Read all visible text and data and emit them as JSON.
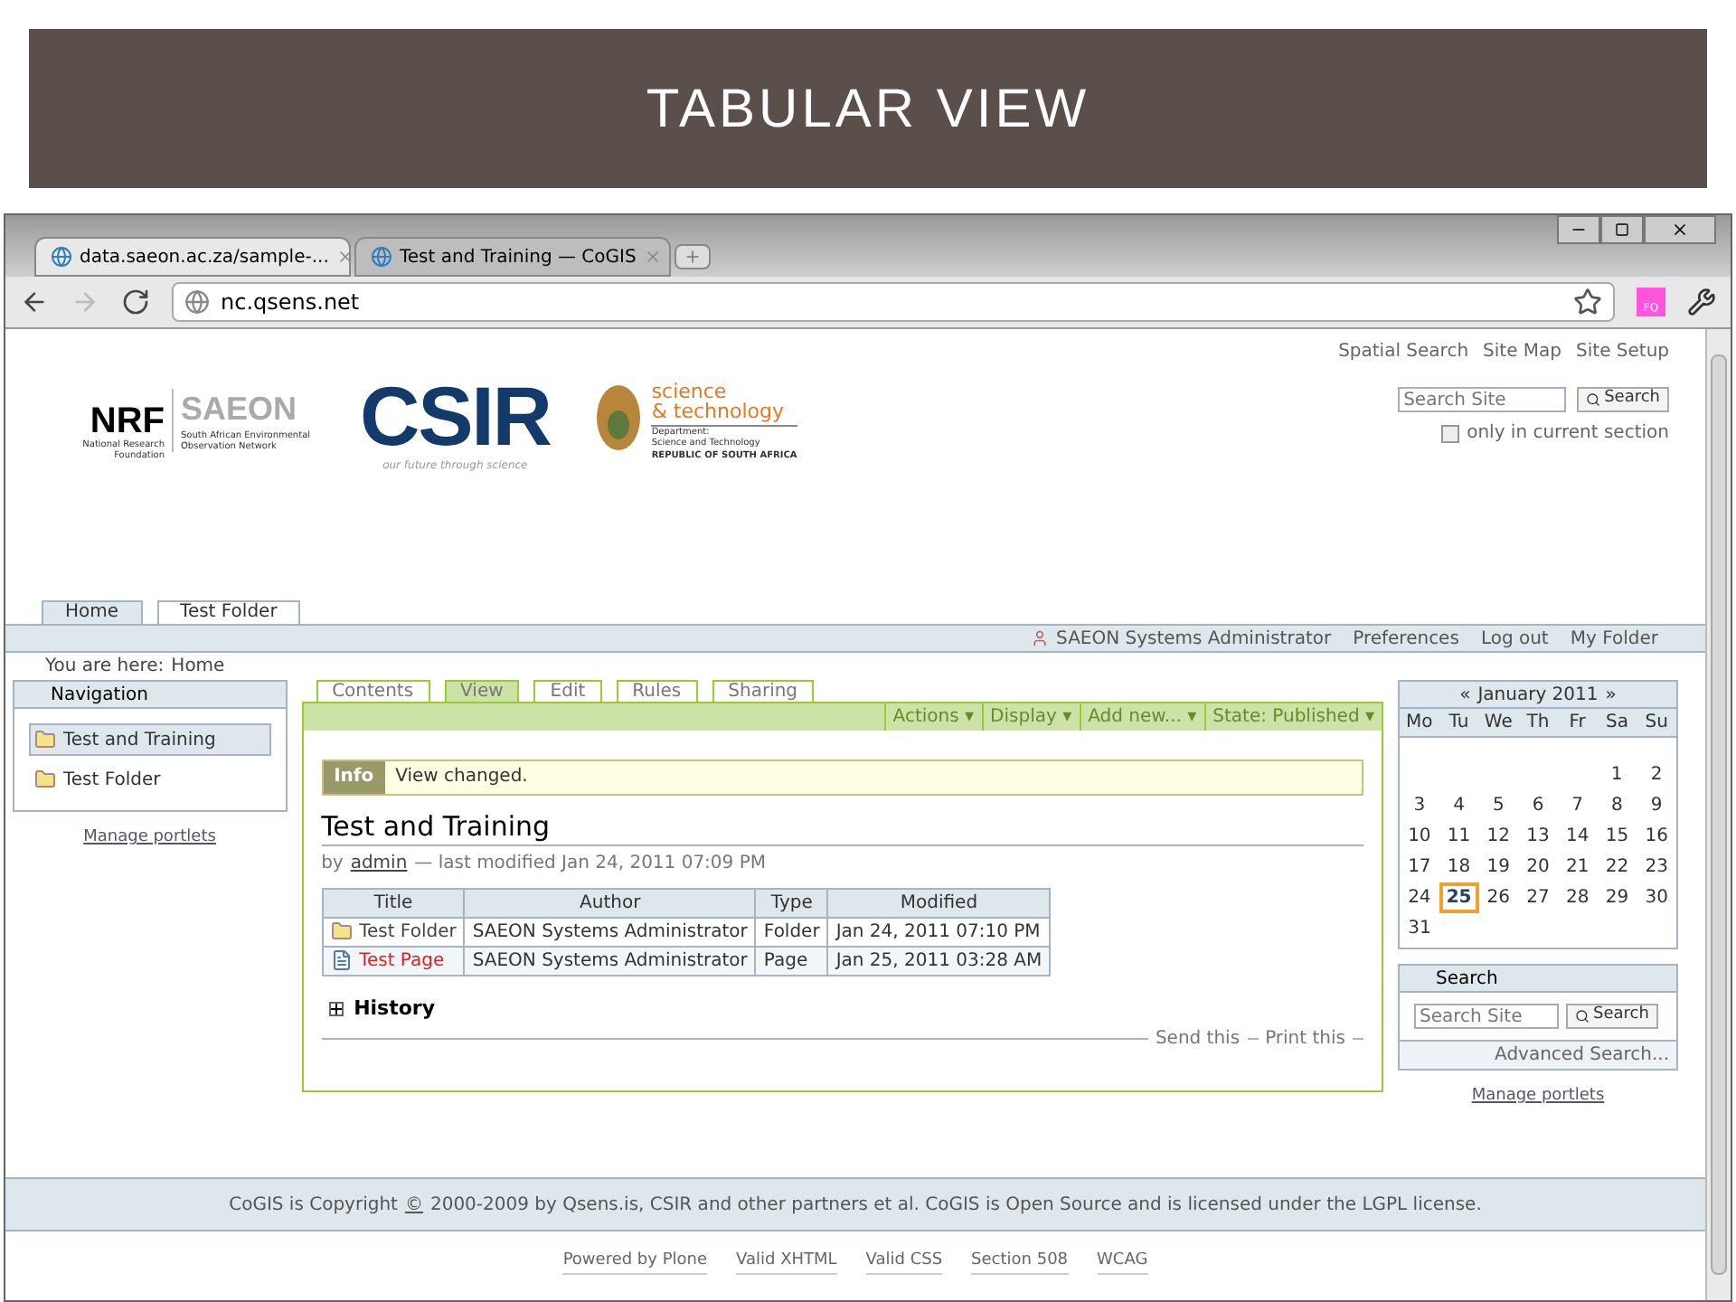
{
  "slide": {
    "title": "TABULAR VIEW"
  },
  "browser": {
    "tabs": [
      {
        "label": "data.saeon.ac.za/sample-...",
        "selected": true
      },
      {
        "label": "Test and Training — CoGIS",
        "selected": false
      }
    ],
    "address": "nc.qsens.net",
    "extension_badge": "FQ"
  },
  "logos": {
    "nrf": {
      "mark": "NRF",
      "name": "National Research Foundation"
    },
    "saeon": {
      "mark": "SAEON",
      "name": "South African Environmental Observation Network"
    },
    "csir": {
      "mark": "CSIR",
      "tagline": "our future through science"
    },
    "dst": {
      "line_1": "science",
      "line_2": "& technology",
      "dept": "Department:",
      "dept_name": "Science and Technology",
      "country": "REPUBLIC OF SOUTH AFRICA"
    }
  },
  "site_actions": [
    "Spatial Search",
    "Site Map",
    "Site Setup"
  ],
  "site_search": {
    "placeholder": "Search Site",
    "button": "Search",
    "option": {
      "label": "only in current section",
      "checked": false
    }
  },
  "sections": [
    {
      "label": "Home",
      "selected": true
    },
    {
      "label": "Test Folder",
      "selected": false
    }
  ],
  "personal_bar": {
    "user": "SAEON Systems Administrator",
    "links": [
      "Preferences",
      "Log out",
      "My Folder"
    ]
  },
  "breadcrumbs": {
    "label": "You are here:",
    "items": [
      "Home"
    ]
  },
  "navigation": {
    "title": "Navigation",
    "items": [
      {
        "label": "Test and Training",
        "selected": true
      },
      {
        "label": "Test Folder",
        "selected": false
      }
    ],
    "manage": "Manage portlets"
  },
  "content_tabs": [
    {
      "label": "Contents",
      "selected": false
    },
    {
      "label": "View",
      "selected": true
    },
    {
      "label": "Edit",
      "selected": false
    },
    {
      "label": "Rules",
      "selected": false
    },
    {
      "label": "Sharing",
      "selected": false
    }
  ],
  "content_menus": [
    "Actions ▾",
    "Display ▾",
    "Add new... ▾",
    "State: Published ▾"
  ],
  "message": {
    "type": "Info",
    "text": "View changed."
  },
  "document": {
    "title": "Test and Training",
    "byline_prefix": "by",
    "author": "admin",
    "byline_suffix": "— last modified Jan 24, 2011 07:09 PM"
  },
  "table": {
    "columns": [
      "Title",
      "Author",
      "Type",
      "Modified"
    ],
    "rows": [
      {
        "kind": "folder",
        "title": "Test Folder",
        "author": "SAEON Systems Administrator",
        "type": "Folder",
        "modified": "Jan 24, 2011 07:10 PM"
      },
      {
        "kind": "page",
        "title": "Test Page",
        "author": "SAEON Systems Administrator",
        "type": "Page",
        "modified": "Jan 25, 2011 03:28 AM"
      }
    ]
  },
  "history": {
    "label": "History",
    "expanded": false
  },
  "document_actions": [
    "Send this",
    "Print this"
  ],
  "calendar": {
    "prev": "«",
    "month": "January 2011",
    "next": "»",
    "weekdays": [
      "Mo",
      "Tu",
      "We",
      "Th",
      "Fr",
      "Sa",
      "Su"
    ],
    "weeks": [
      {
        "kind": "start",
        "days": [
          {
            "day": "1",
            "selected": false
          },
          {
            "day": "2",
            "selected": false
          }
        ]
      },
      {
        "kind": "full",
        "days": [
          {
            "day": "3",
            "selected": false
          },
          {
            "day": "4",
            "selected": false
          },
          {
            "day": "5",
            "selected": false
          },
          {
            "day": "6",
            "selected": false
          },
          {
            "day": "7",
            "selected": false
          },
          {
            "day": "8",
            "selected": false
          },
          {
            "day": "9",
            "selected": false
          }
        ]
      },
      {
        "kind": "full",
        "days": [
          {
            "day": "10",
            "selected": false
          },
          {
            "day": "11",
            "selected": false
          },
          {
            "day": "12",
            "selected": false
          },
          {
            "day": "13",
            "selected": false
          },
          {
            "day": "14",
            "selected": false
          },
          {
            "day": "15",
            "selected": false
          },
          {
            "day": "16",
            "selected": false
          }
        ]
      },
      {
        "kind": "full",
        "days": [
          {
            "day": "17",
            "selected": false
          },
          {
            "day": "18",
            "selected": false
          },
          {
            "day": "19",
            "selected": false
          },
          {
            "day": "20",
            "selected": false
          },
          {
            "day": "21",
            "selected": false
          },
          {
            "day": "22",
            "selected": false
          },
          {
            "day": "23",
            "selected": false
          }
        ]
      },
      {
        "kind": "full",
        "days": [
          {
            "day": "24",
            "selected": false
          },
          {
            "day": "25",
            "selected": true
          },
          {
            "day": "26",
            "selected": false
          },
          {
            "day": "27",
            "selected": false
          },
          {
            "day": "28",
            "selected": false
          },
          {
            "day": "29",
            "selected": false
          },
          {
            "day": "30",
            "selected": false
          }
        ]
      },
      {
        "kind": "end",
        "days": [
          {
            "day": "31",
            "selected": false
          }
        ]
      }
    ]
  },
  "search_portlet": {
    "title": "Search",
    "placeholder": "Search Site",
    "button": "Search",
    "advanced": "Advanced Search...",
    "manage": "Manage portlets"
  },
  "footer": {
    "copyright_prefix": "CoGIS is Copyright",
    "copyright_sign": "©",
    "copyright_suffix": "2000-2009 by Qsens.is, CSIR and other partners et al. CoGIS is Open Source and is licensed under the LGPL license.",
    "colophon": [
      "Powered by Plone",
      "Valid XHTML",
      "Valid CSS",
      "Section 508",
      "WCAG"
    ]
  }
}
